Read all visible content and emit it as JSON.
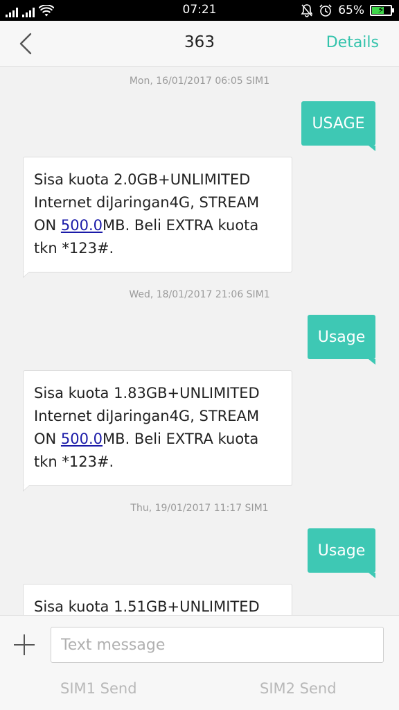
{
  "status_bar": {
    "time": "07:21",
    "battery_percent": "65%",
    "battery_level": 0.65,
    "icons": [
      "signal-sim1-icon",
      "signal-sim2-icon",
      "wifi-icon",
      "mute-icon",
      "alarm-icon",
      "battery-charging-icon"
    ]
  },
  "header": {
    "title": "363",
    "details_label": "Details",
    "back_icon": "chevron-left-icon"
  },
  "conversation": [
    {
      "timestamp": "Mon, 16/01/2017  06:05  SIM1",
      "sent": "USAGE",
      "received": {
        "before": "Sisa kuota 2.0GB+UNLIMITED Internet diJaringan4G, STREAM ON ",
        "link": "500.0",
        "after": "MB. Beli EXTRA kuota tkn *123#."
      }
    },
    {
      "timestamp": "Wed, 18/01/2017  21:06  SIM1",
      "sent": "Usage",
      "received": {
        "before": "Sisa kuota 1.83GB+UNLIMITED Internet diJaringan4G, STREAM ON ",
        "link": "500.0",
        "after": "MB. Beli EXTRA kuota tkn *123#."
      }
    },
    {
      "timestamp": "Thu, 19/01/2017  11:17  SIM1",
      "sent": "Usage",
      "received": {
        "before": "Sisa kuota 1.51GB+UNLIMITED"
      }
    }
  ],
  "compose": {
    "placeholder": "Text message",
    "add_icon": "plus-icon",
    "sim1_send": "SIM1 Send",
    "sim2_send": "SIM2 Send"
  },
  "colors": {
    "accent": "#33c3ac",
    "sent_bubble": "#3ec8b4",
    "link": "#1a1aa8",
    "battery_fill": "#3fd64a"
  }
}
